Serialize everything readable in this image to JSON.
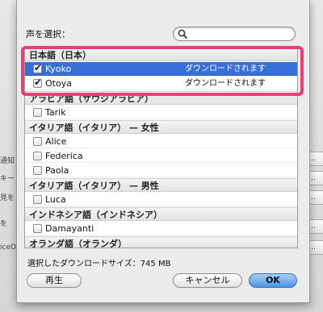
{
  "dialog": {
    "voice_label": "声を選択：",
    "search": {
      "placeholder": "",
      "value": ""
    },
    "download_size": "選択したダウンロードサイズ：745 MB",
    "buttons": {
      "play": "再生",
      "cancel": "キャンセル",
      "ok": "OK"
    }
  },
  "voice_list": [
    {
      "type": "group",
      "label": "日本語（日本）"
    },
    {
      "type": "voice",
      "name": "Kyoko",
      "checked": true,
      "selected": true,
      "status": "ダウンロードされます"
    },
    {
      "type": "voice",
      "name": "Otoya",
      "checked": true,
      "selected": false,
      "status": "ダウンロードされます"
    },
    {
      "type": "group",
      "label": "アラビア語（サウジアラビア）"
    },
    {
      "type": "voice",
      "name": "Tarik",
      "checked": false,
      "selected": false,
      "status": ""
    },
    {
      "type": "group",
      "label": "イタリア語（イタリア） — 女性"
    },
    {
      "type": "voice",
      "name": "Alice",
      "checked": false,
      "selected": false,
      "status": ""
    },
    {
      "type": "voice",
      "name": "Federica",
      "checked": false,
      "selected": false,
      "status": ""
    },
    {
      "type": "voice",
      "name": "Paola",
      "checked": false,
      "selected": false,
      "status": ""
    },
    {
      "type": "group",
      "label": "イタリア語（イタリア） — 男性"
    },
    {
      "type": "voice",
      "name": "Luca",
      "checked": false,
      "selected": false,
      "status": ""
    },
    {
      "type": "group",
      "label": "インドネシア語（インドネシア）"
    },
    {
      "type": "voice",
      "name": "Damayanti",
      "checked": false,
      "selected": false,
      "status": ""
    },
    {
      "type": "group",
      "label": "オランダ語（オランダ）"
    }
  ],
  "background": {
    "left_fragments": [
      "通知",
      "キー",
      "見を",
      "を",
      "iceO"
    ]
  },
  "colors": {
    "selection": "#3670d6",
    "highlight_border": "#ee3d7a",
    "ok_button": "#4d95e6"
  }
}
